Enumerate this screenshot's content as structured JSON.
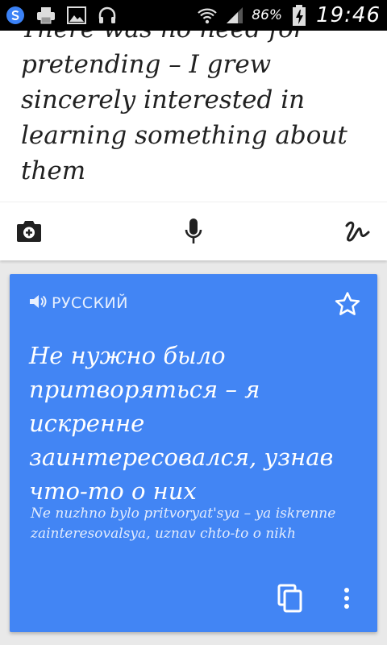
{
  "status_bar": {
    "battery_percent": "86%",
    "time": "19:46"
  },
  "source": {
    "text": "There was no need for pretending – I grew sincerely interested in learning something about them"
  },
  "toolbar": {
    "camera_icon": "camera-plus-icon",
    "mic_icon": "microphone-icon",
    "handwriting_icon": "handwriting-icon"
  },
  "translation_card": {
    "language": "РУССКИЙ",
    "translation": "Не нужно было притворяться – я искренне заинтересовался, узнав что-то о них",
    "transliteration": "Ne nuzhno bylo pritvoryat'sya – ya iskrenne zainteresovalsya, uznav chto-to o nikh",
    "accent_color": "#4285f4"
  }
}
